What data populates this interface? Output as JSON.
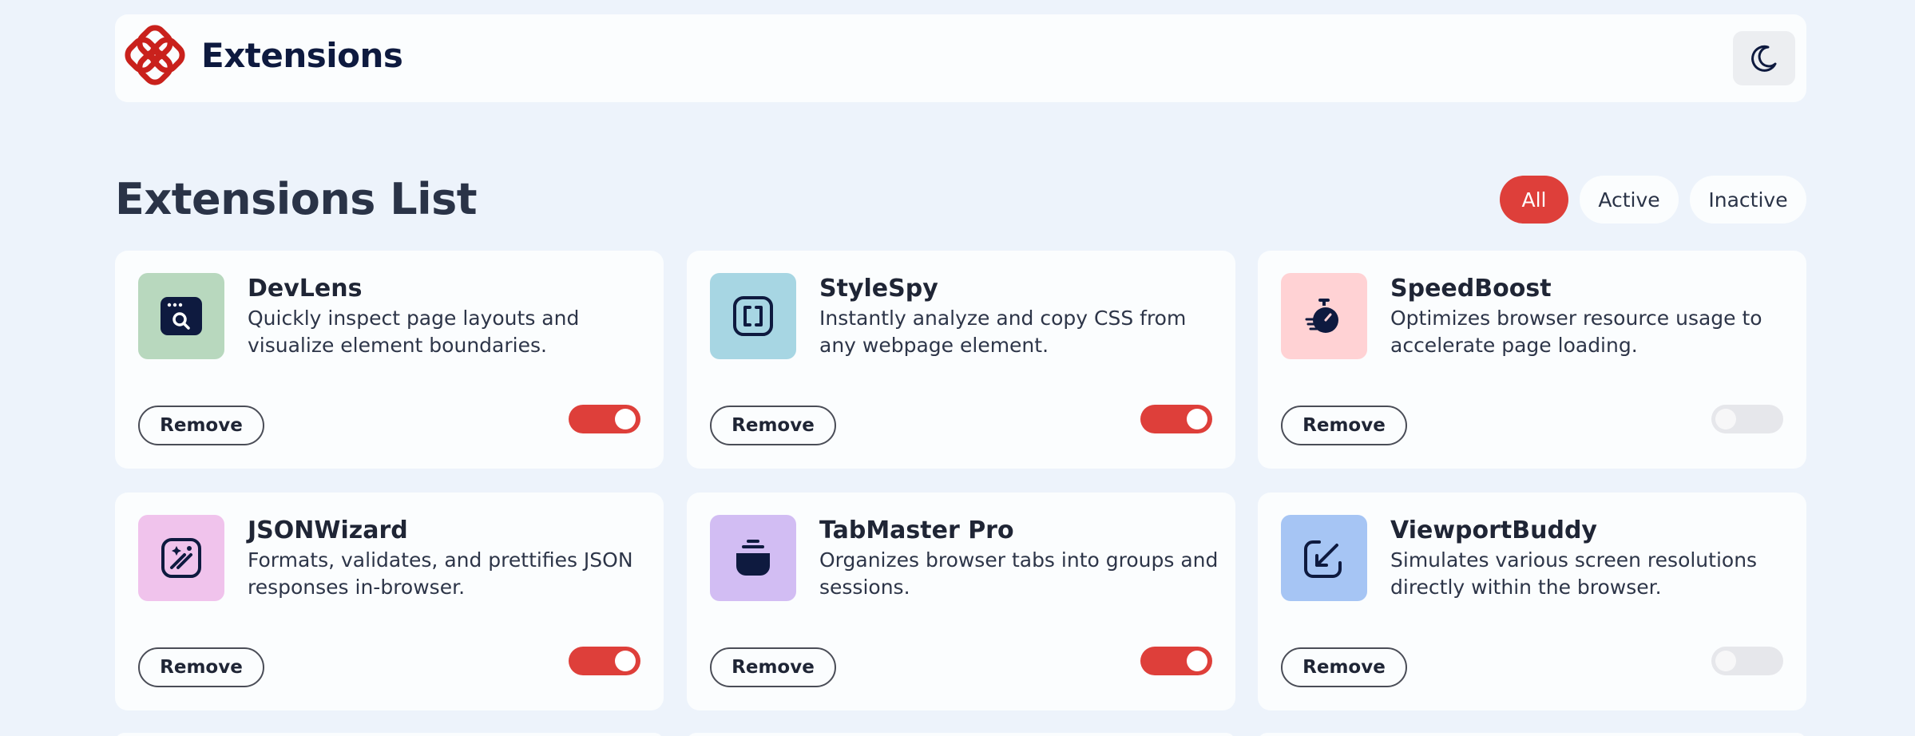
{
  "header": {
    "brand": "Extensions",
    "theme_icon": "moon-icon",
    "logo_color": "#c9211c"
  },
  "list": {
    "title": "Extensions List",
    "filters": [
      {
        "label": "All",
        "selected": true
      },
      {
        "label": "Active",
        "selected": false
      },
      {
        "label": "Inactive",
        "selected": false
      }
    ]
  },
  "colors": {
    "accent": "#de3f3a",
    "background": "#edf3fb",
    "card": "#fbfdfe"
  },
  "extensions": [
    {
      "name": "DevLens",
      "description": "Quickly inspect page layouts and visualize element boundaries.",
      "remove_label": "Remove",
      "active": true,
      "icon": "inspect-window-icon",
      "icon_bg": "#b8d8be"
    },
    {
      "name": "StyleSpy",
      "description": "Instantly analyze and copy CSS from any webpage element.",
      "remove_label": "Remove",
      "active": true,
      "icon": "code-brackets-icon",
      "icon_bg": "#a7d6e3"
    },
    {
      "name": "SpeedBoost",
      "description": "Optimizes browser resource usage to accelerate page loading.",
      "remove_label": "Remove",
      "active": false,
      "icon": "stopwatch-icon",
      "icon_bg": "#ffd2d4"
    },
    {
      "name": "JSONWizard",
      "description": "Formats, validates, and prettifies JSON responses in-browser.",
      "remove_label": "Remove",
      "active": true,
      "icon": "magic-wand-icon",
      "icon_bg": "#f0c3ec"
    },
    {
      "name": "TabMaster Pro",
      "description": "Organizes browser tabs into groups and sessions.",
      "remove_label": "Remove",
      "active": true,
      "icon": "tab-stack-icon",
      "icon_bg": "#d2bdf3"
    },
    {
      "name": "ViewportBuddy",
      "description": "Simulates various screen resolutions directly within the browser.",
      "remove_label": "Remove",
      "active": false,
      "icon": "resize-arrow-icon",
      "icon_bg": "#a6c5f4"
    }
  ]
}
